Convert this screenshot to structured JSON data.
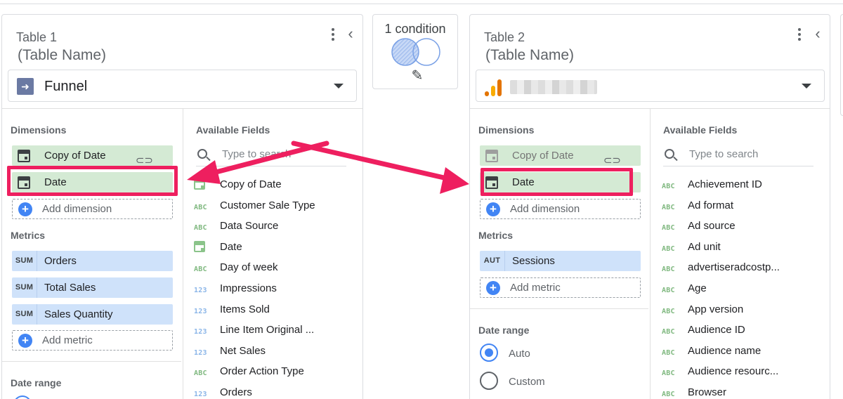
{
  "condition": {
    "label": "1 condition",
    "edit_icon": "pencil-icon",
    "venn_icon": "venn-diagram-icon"
  },
  "colors": {
    "highlight": "#ee1f5f",
    "dimension_chip": "#d4ead4",
    "metric_chip": "#cfe2fa",
    "accent": "#4285f4"
  },
  "table1": {
    "title": "Table 1",
    "name_placeholder": "(Table Name)",
    "source": "Funnel",
    "dimensions_label": "Dimensions",
    "dimensions": [
      {
        "label": "Copy of Date",
        "icon": "calendar-icon",
        "linked": true
      },
      {
        "label": "Date",
        "icon": "calendar-icon",
        "linked": false
      }
    ],
    "add_dimension": "Add dimension",
    "metrics_label": "Metrics",
    "metrics": [
      {
        "agg": "SUM",
        "label": "Orders"
      },
      {
        "agg": "SUM",
        "label": "Total Sales"
      },
      {
        "agg": "SUM",
        "label": "Sales Quantity"
      }
    ],
    "add_metric": "Add metric",
    "date_range_label": "Date range",
    "available_label": "Available Fields",
    "search_placeholder": "Type to search",
    "fields": [
      {
        "type": "date",
        "label": "Copy of Date"
      },
      {
        "type": "ABC",
        "label": "Customer Sale Type"
      },
      {
        "type": "ABC",
        "label": "Data Source"
      },
      {
        "type": "date",
        "label": "Date"
      },
      {
        "type": "ABC",
        "label": "Day of week"
      },
      {
        "type": "123",
        "label": "Impressions"
      },
      {
        "type": "123",
        "label": "Items Sold"
      },
      {
        "type": "123",
        "label": "Line Item Original ..."
      },
      {
        "type": "123",
        "label": "Net Sales"
      },
      {
        "type": "ABC",
        "label": "Order Action Type"
      },
      {
        "type": "123",
        "label": "Orders"
      }
    ]
  },
  "table2": {
    "title": "Table 2",
    "name_placeholder": "(Table Name)",
    "source_icon": "google-analytics-icon",
    "dimensions_label": "Dimensions",
    "dimensions": [
      {
        "label": "Copy of Date",
        "icon": "calendar-icon",
        "linked": true
      },
      {
        "label": "Date",
        "icon": "calendar-icon",
        "linked": false
      }
    ],
    "add_dimension": "Add dimension",
    "metrics_label": "Metrics",
    "metrics": [
      {
        "agg": "AUT",
        "label": "Sessions"
      }
    ],
    "add_metric": "Add metric",
    "date_range_label": "Date range",
    "date_range_options": [
      "Auto",
      "Custom"
    ],
    "date_range_selected": "Auto",
    "available_label": "Available Fields",
    "search_placeholder": "Type to search",
    "fields": [
      {
        "type": "ABC",
        "label": "Achievement ID"
      },
      {
        "type": "ABC",
        "label": "Ad format"
      },
      {
        "type": "ABC",
        "label": "Ad source"
      },
      {
        "type": "ABC",
        "label": "Ad unit"
      },
      {
        "type": "ABC",
        "label": "advertiseradcostp..."
      },
      {
        "type": "ABC",
        "label": "Age"
      },
      {
        "type": "ABC",
        "label": "App version"
      },
      {
        "type": "ABC",
        "label": "Audience ID"
      },
      {
        "type": "ABC",
        "label": "Audience name"
      },
      {
        "type": "ABC",
        "label": "Audience resourc..."
      },
      {
        "type": "ABC",
        "label": "Browser"
      }
    ]
  }
}
